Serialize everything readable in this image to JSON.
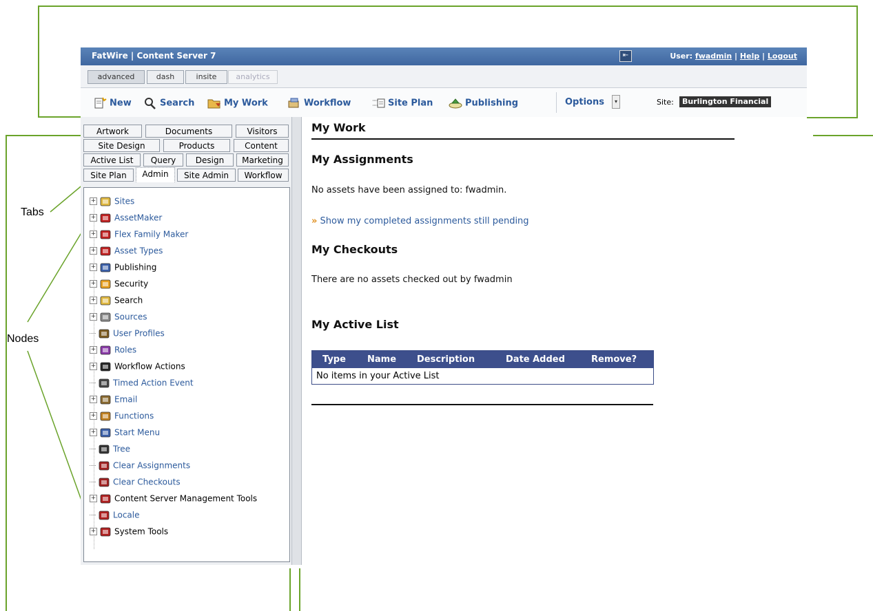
{
  "annotations": {
    "tabs": "Tabs",
    "nodes": "Nodes"
  },
  "titlebar": {
    "brand": "FatWire | Content Server 7",
    "user_prefix": "User: ",
    "username": "fwadmin",
    "sep1": " | ",
    "help": "Help",
    "sep2": " | ",
    "logout": "Logout",
    "collapse_glyph": "⇤"
  },
  "modes": [
    "advanced",
    "dash",
    "insite",
    "analytics"
  ],
  "toolbar": {
    "new": "New",
    "search": "Search",
    "my_work": "My Work",
    "workflow": "Workflow",
    "site_plan": "Site Plan",
    "publishing": "Publishing",
    "options": "Options",
    "options_arrow": "▾",
    "site_label": "Site:",
    "site_value": "Burlington Financial"
  },
  "tabs": {
    "row1": [
      "Artwork",
      "Documents",
      "Visitors"
    ],
    "row2": [
      "Site Design",
      "Products",
      "Content"
    ],
    "row3": [
      "Active List",
      "Query",
      "Design",
      "Marketing"
    ],
    "row4": [
      "Site Plan",
      "Admin",
      "Site Admin",
      "Workflow"
    ],
    "active": "Admin"
  },
  "tree": [
    {
      "label": "Sites",
      "icon": "sites-icon",
      "expandable": true,
      "link": true,
      "color": "#e0b840"
    },
    {
      "label": "AssetMaker",
      "icon": "assetmaker-icon",
      "expandable": true,
      "link": true,
      "color": "#c02020"
    },
    {
      "label": "Flex Family Maker",
      "icon": "flex-family-maker-icon",
      "expandable": true,
      "link": true,
      "color": "#c02020"
    },
    {
      "label": "Asset Types",
      "icon": "asset-types-icon",
      "expandable": true,
      "link": true,
      "color": "#c02020"
    },
    {
      "label": "Publishing",
      "icon": "publishing-icon",
      "expandable": true,
      "link": false,
      "color": "#3a5fa8"
    },
    {
      "label": "Security",
      "icon": "security-icon",
      "expandable": true,
      "link": false,
      "color": "#e8a020"
    },
    {
      "label": "Search",
      "icon": "search-folder-icon",
      "expandable": true,
      "link": false,
      "color": "#e0b840"
    },
    {
      "label": "Sources",
      "icon": "sources-icon",
      "expandable": true,
      "link": true,
      "color": "#888888"
    },
    {
      "label": "User Profiles",
      "icon": "user-profiles-icon",
      "expandable": false,
      "link": true,
      "color": "#7a5a20"
    },
    {
      "label": "Roles",
      "icon": "roles-icon",
      "expandable": true,
      "link": true,
      "color": "#8a3aa8"
    },
    {
      "label": "Workflow Actions",
      "icon": "workflow-actions-icon",
      "expandable": true,
      "link": false,
      "color": "#222222"
    },
    {
      "label": "Timed Action Event",
      "icon": "timed-action-event-icon",
      "expandable": false,
      "link": true,
      "color": "#444444"
    },
    {
      "label": "Email",
      "icon": "email-icon",
      "expandable": true,
      "link": true,
      "color": "#8a6a30"
    },
    {
      "label": "Functions",
      "icon": "functions-icon",
      "expandable": true,
      "link": true,
      "color": "#c08020"
    },
    {
      "label": "Start Menu",
      "icon": "start-menu-icon",
      "expandable": true,
      "link": true,
      "color": "#3a5fa8"
    },
    {
      "label": "Tree",
      "icon": "tree-icon",
      "expandable": false,
      "link": true,
      "color": "#333333"
    },
    {
      "label": "Clear Assignments",
      "icon": "clear-assignments-icon",
      "expandable": false,
      "link": true,
      "color": "#a02020"
    },
    {
      "label": "Clear Checkouts",
      "icon": "clear-checkouts-icon",
      "expandable": false,
      "link": true,
      "color": "#a02020"
    },
    {
      "label": "Content Server Management Tools",
      "icon": "cs-management-tools-icon",
      "expandable": true,
      "link": false,
      "color": "#b02020"
    },
    {
      "label": "Locale",
      "icon": "locale-icon",
      "expandable": false,
      "link": true,
      "color": "#b02020"
    },
    {
      "label": "System Tools",
      "icon": "system-tools-icon",
      "expandable": true,
      "link": false,
      "color": "#b02020"
    }
  ],
  "main": {
    "my_work_title": "My Work",
    "assignments_title": "My Assignments",
    "no_assignments": "No assets have been assigned to: fwadmin.",
    "show_completed_arrow": "»",
    "show_completed": "Show my completed assignments still pending",
    "checkouts_title": "My Checkouts",
    "no_checkouts": "There are no assets checked out by fwadmin",
    "active_list_title": "My Active List",
    "table_headers": [
      "Type",
      "Name",
      "Description",
      "Date Added",
      "Remove?"
    ],
    "table_empty": "No items in your Active List"
  },
  "colors": {
    "titlebar": "#4a74ae",
    "link": "#2c5a9c",
    "table_header": "#3d4f8c",
    "annotation_line": "#6aa32a"
  }
}
